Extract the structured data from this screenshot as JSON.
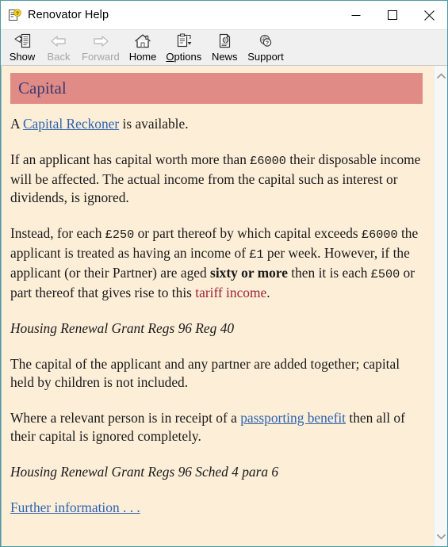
{
  "window": {
    "title": "Renovator Help",
    "icon": "help-document-icon",
    "border_color": "#4a9aa5",
    "controls": [
      {
        "name": "minimize",
        "label": "—"
      },
      {
        "name": "maximize",
        "label": "☐"
      },
      {
        "name": "close",
        "label": "✕"
      }
    ]
  },
  "toolbar": {
    "background": "#f0f0f0",
    "buttons": [
      {
        "name": "show",
        "label": "Show",
        "icon": "show-panel-icon",
        "enabled": true,
        "accel": ""
      },
      {
        "name": "back",
        "label": "Back",
        "icon": "arrow-left-icon",
        "enabled": false,
        "accel": ""
      },
      {
        "name": "forward",
        "label": "Forward",
        "icon": "arrow-right-icon",
        "enabled": false,
        "accel": ""
      },
      {
        "name": "home",
        "label": "Home",
        "icon": "house-icon",
        "enabled": true,
        "accel": ""
      },
      {
        "name": "options",
        "label": "Options",
        "icon": "clipboard-menu-icon",
        "enabled": true,
        "accel": "O"
      },
      {
        "name": "news",
        "label": "News",
        "icon": "page-globe-icon",
        "enabled": true,
        "accel": ""
      },
      {
        "name": "support",
        "label": "Support",
        "icon": "globe-question-icon",
        "enabled": true,
        "accel": ""
      }
    ]
  },
  "document": {
    "background": "#fdeed8",
    "heading": {
      "text": "Capital",
      "banner_color": "#e08b86",
      "text_color": "#3c3a72"
    },
    "link_color": "#2c63b0",
    "glossary_color": "#9b2335",
    "paragraphs": {
      "p1_a": "A ",
      "p1_link": "Capital Reckoner",
      "p1_b": " is available.",
      "p2_a": "If an applicant has capital worth more than ",
      "p2_m1": "£6000",
      "p2_b": " their disposable income will be affected. The actual income from the capital such as interest or dividends, is ignored.",
      "p3_a": "Instead, for each ",
      "p3_m1": "£250",
      "p3_b": " or part thereof by which capital exceeds ",
      "p3_m2": "£6000",
      "p3_c": " the applicant is treated as having an income of ",
      "p3_m3": "£1",
      "p3_d": " per week. However, if the applicant (or their Partner) are aged ",
      "p3_bold": "sixty or more",
      "p3_e": " then it is each ",
      "p3_m4": "£500",
      "p3_f": " or part thereof that gives rise to this ",
      "p3_gloss": "tariff income",
      "p3_g": ".",
      "cite1": "Housing Renewal Grant Regs 96 Reg 40",
      "p4": "The capital of the applicant and any partner are added together; capital held by children is not included.",
      "p5_a": "Where a relevant person is in receipt of a ",
      "p5_link": "passporting benefit",
      "p5_b": " then all of their capital is ignored completely.",
      "cite2": "Housing Renewal Grant Regs 96 Sched 4 para 6",
      "further_link": "Further information . . ."
    }
  },
  "scrollbar": {
    "up_icon": "chevron-up-icon",
    "down_icon": "chevron-down-icon"
  }
}
